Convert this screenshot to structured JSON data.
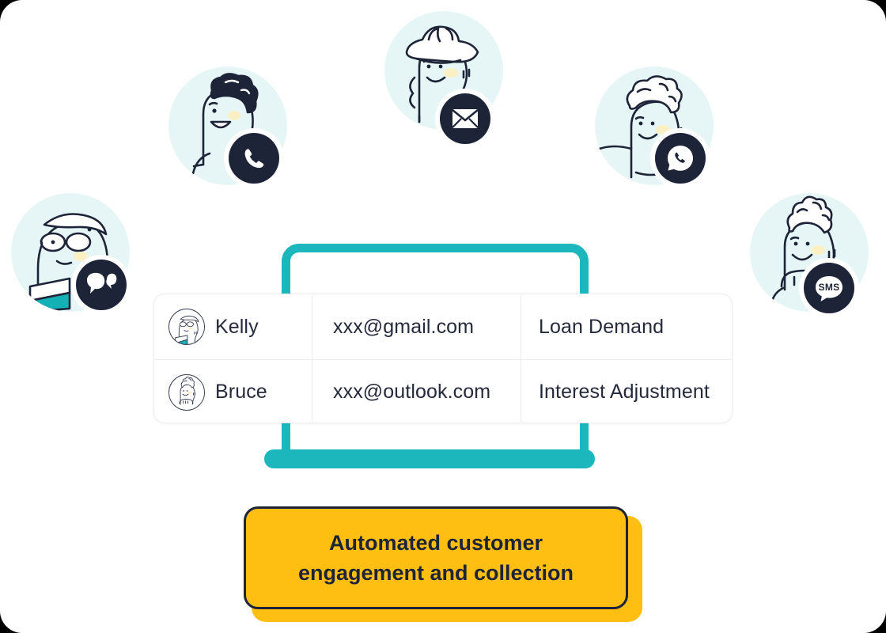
{
  "theme": {
    "teal": "#1cb7bc",
    "yellow": "#ffbe12",
    "ink": "#1e2438",
    "avatar_disc": "#e6f6f6",
    "page_bg": "#ffffff",
    "border": "#ededf0"
  },
  "personas": [
    {
      "id": "chat-persona",
      "name": "persona-chat",
      "channel": "chat",
      "badge_icon": "chat-bubbles-icon",
      "character": "glasses-reader"
    },
    {
      "id": "phone-persona",
      "name": "persona-phone",
      "channel": "phone",
      "badge_icon": "phone-icon",
      "character": "curly-hair-smiling"
    },
    {
      "id": "email-persona",
      "name": "persona-email",
      "channel": "email",
      "badge_icon": "envelope-icon",
      "character": "hat-wearing"
    },
    {
      "id": "whatsapp-persona",
      "name": "persona-whatsapp",
      "channel": "whatsapp",
      "badge_icon": "whatsapp-icon",
      "character": "wavy-hair"
    },
    {
      "id": "sms-persona",
      "name": "persona-sms",
      "channel": "sms",
      "badge_icon": "sms-icon",
      "badge_text": "SMS",
      "character": "tall-hair"
    }
  ],
  "device": {
    "type": "laptop",
    "frame_color": "#1cb7bc"
  },
  "table": {
    "rows": [
      {
        "avatar": "kelly-avatar",
        "name": "Kelly",
        "email": "xxx@gmail.com",
        "topic": "Loan Demand"
      },
      {
        "avatar": "bruce-avatar",
        "name": "Bruce",
        "email": "xxx@outlook.com",
        "topic": "Interest Adjustment"
      }
    ]
  },
  "cta": {
    "line1": "Automated customer",
    "line2": "engagement and collection"
  }
}
